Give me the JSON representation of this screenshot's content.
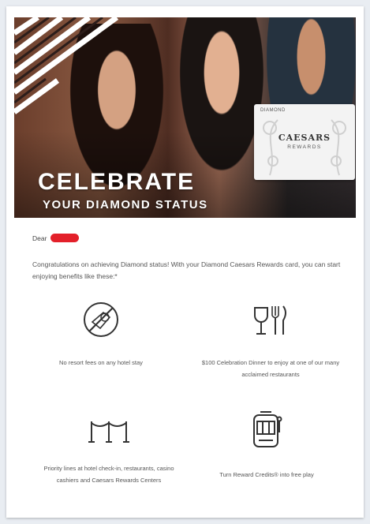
{
  "hero": {
    "headline": "CELEBRATE",
    "subheadline": "YOUR DIAMOND STATUS",
    "card": {
      "tier": "DIAMOND",
      "brand": "CAESARS",
      "sub": "REWARDS"
    }
  },
  "greeting": {
    "salutation": "Dear"
  },
  "intro": "Congratulations on achieving Diamond status! With your Diamond Caesars Rewards card, you can start enjoying benefits like these:*",
  "benefits": [
    {
      "icon": "no-resort-fee-icon",
      "text": "No resort fees on any hotel stay"
    },
    {
      "icon": "wine-and-cutlery-icon",
      "text": "$100 Celebration Dinner to enjoy at one of our many acclaimed restaurants"
    },
    {
      "icon": "priority-line-icon",
      "text": "Priority lines at hotel check-in, restaurants, casino cashiers and Caesars Rewards Centers"
    },
    {
      "icon": "slot-machine-icon",
      "text": "Turn Reward Credits® into free play"
    }
  ],
  "colors": {
    "redaction": "#e3202a",
    "body_text": "#555555",
    "background": "#e9edf2"
  }
}
